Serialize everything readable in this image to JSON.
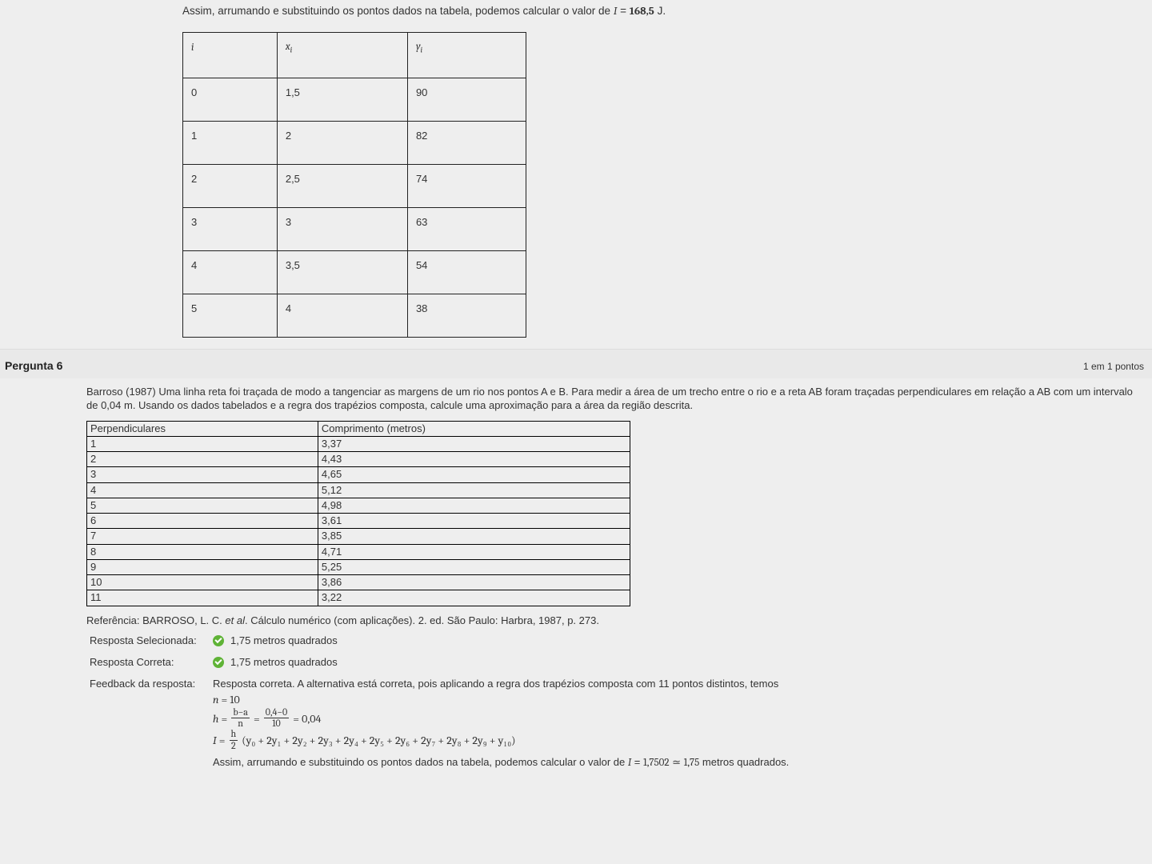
{
  "upper": {
    "intro_prefix": "Assim, arrumando e substituindo os pontos dados na tabela, podemos calcular o valor de ",
    "intro_I": "I",
    "intro_eq": " = ",
    "intro_value": "168,5",
    "intro_unit": " J.",
    "table": {
      "headers": {
        "i": "i",
        "x": "x",
        "x_sub": "i",
        "y": "y",
        "y_sub": "i"
      },
      "rows": [
        {
          "i": "0",
          "x": "1,5",
          "y": "90"
        },
        {
          "i": "1",
          "x": "2",
          "y": "82"
        },
        {
          "i": "2",
          "x": "2,5",
          "y": "74"
        },
        {
          "i": "3",
          "x": "3",
          "y": "63"
        },
        {
          "i": "4",
          "x": "3,5",
          "y": "54"
        },
        {
          "i": "5",
          "x": "4",
          "y": "38"
        }
      ]
    }
  },
  "question": {
    "title": "Pergunta 6",
    "points": "1 em 1 pontos",
    "text": "Barroso (1987) Uma linha reta foi traçada de modo a tangenciar as margens de um rio nos pontos A e B. Para medir a área de um trecho entre o rio e a reta AB foram traçadas perpendiculares em relação a AB com um intervalo de 0,04 m. Usando os dados tabelados e a regra dos trapézios composta, calcule uma aproximação para a área da região descrita.",
    "table": {
      "headers": {
        "c1": "Perpendiculares",
        "c2": "Comprimento (metros)"
      },
      "rows": [
        {
          "p": "1",
          "c": "3,37"
        },
        {
          "p": "2",
          "c": "4,43"
        },
        {
          "p": "3",
          "c": "4,65"
        },
        {
          "p": "4",
          "c": "5,12"
        },
        {
          "p": "5",
          "c": "4,98"
        },
        {
          "p": "6",
          "c": "3,61"
        },
        {
          "p": "7",
          "c": "3,85"
        },
        {
          "p": "8",
          "c": "4,71"
        },
        {
          "p": "9",
          "c": "5,25"
        },
        {
          "p": "10",
          "c": "3,86"
        },
        {
          "p": "11",
          "c": "3,22"
        }
      ]
    },
    "reference_pre": "Referência: BARROSO, L. C. ",
    "reference_etal": "et al",
    "reference_post": ". Cálculo numérico (com aplicações). 2. ed. São Paulo: Harbra, 1987, p. 273.",
    "selected_label": "Resposta Selecionada:",
    "selected_value": "1,75 metros quadrados",
    "correct_label": "Resposta Correta:",
    "correct_value": "1,75 metros quadrados",
    "feedback_label": "Feedback da resposta:",
    "feedback_intro": "Resposta correta. A alternativa está correta, pois aplicando a regra dos trapézios composta com 11 pontos distintos, temos",
    "math": {
      "line1_lhs": "n",
      "line1_rhs": "10",
      "line2_lhs": "h",
      "line2_frac1_num": "b−a",
      "line2_frac1_den": "n",
      "line2_frac2_num": "0,4−0",
      "line2_frac2_den": "10",
      "line2_rhs": "0,04",
      "line3_lhs": "I",
      "line3_frac_num": "h",
      "line3_frac_den": "2",
      "line3_sum": "(y₀ + 2y₁ + 2y₂ + 2y₃ + 2y₄ + 2y₅ + 2y₆ + 2y₇ + 2y₈ + 2y₉ + y₁₀)",
      "final_prefix": "Assim, arrumando e substituindo os pontos dados na tabela, podemos calcular o valor de ",
      "final_I": "I",
      "final_eq": " = ",
      "final_v1": "1,7502",
      "final_approx": " ≃ ",
      "final_v2": "1,75",
      "final_unit": " metros quadrados."
    }
  }
}
